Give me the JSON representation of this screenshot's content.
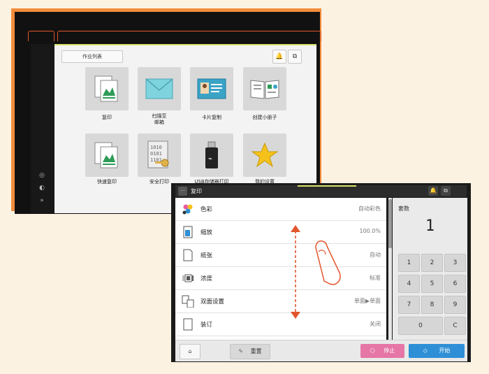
{
  "home_screen": {
    "job_list_label": "作业列表",
    "icons": {
      "bell": "bell-icon",
      "status": "status-icon"
    },
    "apps": [
      {
        "label": "复印",
        "icon": "copy-icon"
      },
      {
        "label": "扫描至\n邮箱",
        "icon": "envelope-icon"
      },
      {
        "label": "卡片复制",
        "icon": "id-card-icon"
      },
      {
        "label": "创建小册子",
        "icon": "booklet-icon"
      },
      {
        "label": "快速复印",
        "icon": "quick-copy-icon"
      },
      {
        "label": "安全打印",
        "icon": "secure-print-icon"
      },
      {
        "label": "USB存储器打印",
        "icon": "usb-icon"
      },
      {
        "label": "我的设置",
        "icon": "star-icon"
      }
    ],
    "side_icons": [
      "settings-icon",
      "contrast-icon",
      "double-chevron-icon"
    ]
  },
  "copy_screen": {
    "title": "复印",
    "settings": [
      {
        "label": "色彩",
        "value": "自动彩色",
        "icon": "color-icon"
      },
      {
        "label": "缩放",
        "value": "100.0%",
        "icon": "zoom-icon"
      },
      {
        "label": "纸张",
        "value": "自动",
        "icon": "paper-icon"
      },
      {
        "label": "浓度",
        "value": "标准",
        "icon": "density-icon"
      },
      {
        "label": "双面设置",
        "value": "单面▶单面",
        "icon": "duplex-icon"
      },
      {
        "label": "装订",
        "value": "关闭",
        "icon": "staple-icon"
      }
    ],
    "copies_label": "套数",
    "copies_value": "1",
    "keypad": [
      "1",
      "2",
      "3",
      "4",
      "5",
      "6",
      "7",
      "8",
      "9",
      "0",
      "C"
    ],
    "buttons": {
      "reset": "重置",
      "stop": "停止",
      "start": "开始"
    },
    "colors": {
      "stop": "#e576a6",
      "start": "#2e8fd6",
      "accent_line": "#d9e26a",
      "swipe_arrow": "#e2552d"
    }
  }
}
